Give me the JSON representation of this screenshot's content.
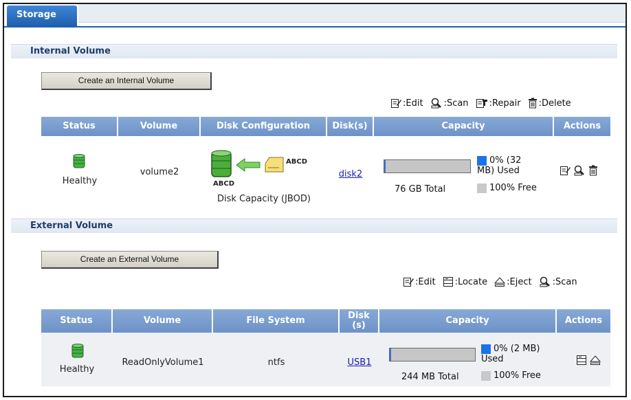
{
  "tabs": [
    {
      "label": "Storage"
    }
  ],
  "internal": {
    "title": "Internal Volume",
    "create_button": "Create an Internal Volume",
    "legend": [
      {
        "icon": "edit-icon",
        "label": ":Edit"
      },
      {
        "icon": "scan-icon",
        "label": ":Scan"
      },
      {
        "icon": "repair-icon",
        "label": ":Repair"
      },
      {
        "icon": "delete-icon",
        "label": ":Delete"
      }
    ],
    "columns": [
      "Status",
      "Volume",
      "Disk Configuration",
      "Disk(s)",
      "Capacity",
      "Actions"
    ],
    "rows": [
      {
        "status": "Healthy",
        "volume": "volume2",
        "disk_config": "Disk Capacity (JBOD)",
        "disk_label_1": "ABCD",
        "disk_label_2": "ABCD",
        "disks": "disk2",
        "used_fraction": 0.0,
        "used_line1": "0% (32",
        "used_line2": "MB) Used",
        "total": "76 GB Total",
        "free": "100% Free"
      }
    ]
  },
  "external": {
    "title": "External Volume",
    "create_button": "Create an External Volume",
    "legend": [
      {
        "icon": "edit-icon",
        "label": ":Edit"
      },
      {
        "icon": "locate-icon",
        "label": ":Locate"
      },
      {
        "icon": "eject-icon",
        "label": ":Eject"
      },
      {
        "icon": "scan-icon",
        "label": ":Scan"
      }
    ],
    "columns": [
      "Status",
      "Volume",
      "File System",
      "Disk",
      "(s)",
      "Capacity",
      "Actions"
    ],
    "rows": [
      {
        "status": "Healthy",
        "volume": "ReadOnlyVolume1",
        "file_system": "ntfs",
        "disks": "USB1",
        "used_fraction": 0.0,
        "used_line1": "0% (2 MB)",
        "used_line2": "Used",
        "total": "244 MB Total",
        "free": "100% Free"
      }
    ]
  },
  "colors": {
    "accent": "#1f60b0",
    "header": "#7a9dcd",
    "used": "#1a73e8",
    "free": "#c8c8c8",
    "healthy": "#3d9e3d"
  }
}
